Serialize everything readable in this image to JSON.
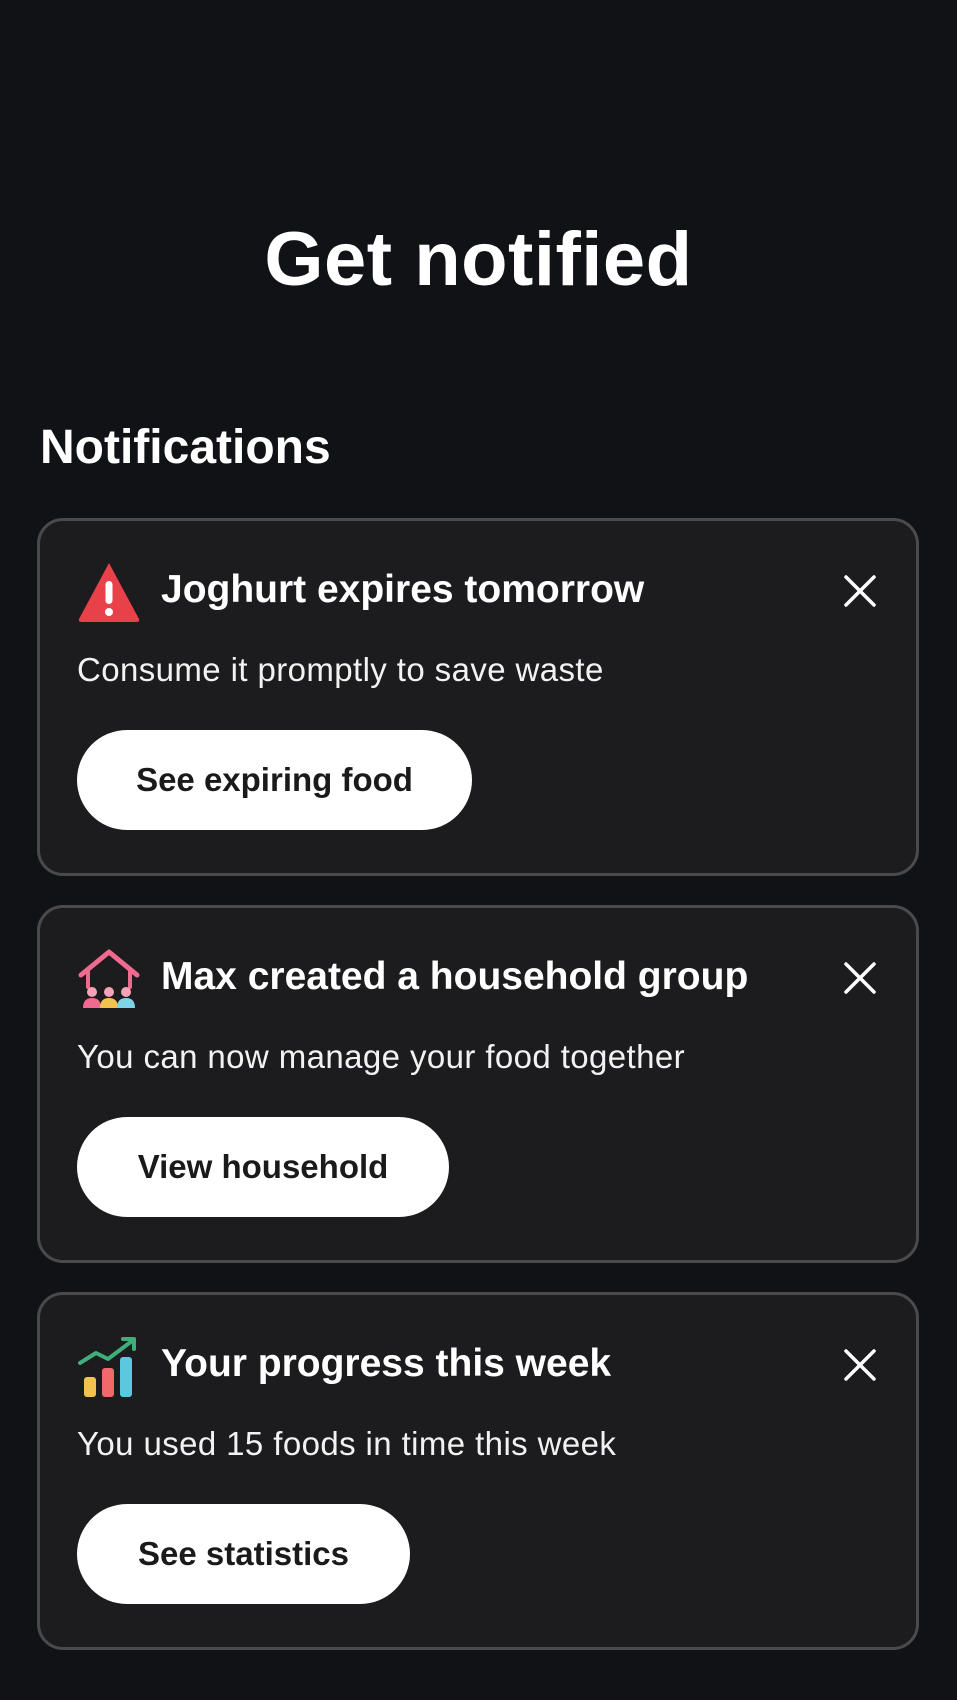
{
  "header": {
    "title": "Get notified"
  },
  "section": {
    "title": "Notifications"
  },
  "notifications": [
    {
      "icon": "warning-triangle-icon",
      "title": "Joghurt expires tomorrow",
      "body": "Consume it promptly to save waste",
      "action_label": "See expiring food"
    },
    {
      "icon": "household-icon",
      "title": "Max created a household group",
      "body": "You can now manage your food together",
      "action_label": "View household"
    },
    {
      "icon": "progress-chart-icon",
      "title": "Your progress this week",
      "body": "You used 15 foods in time this week",
      "action_label": "See statistics"
    }
  ],
  "colors": {
    "background": "#111216",
    "card": "#1c1c1e",
    "card_border": "#4a4a4d",
    "warning": "#e8414a",
    "household": "#f06a8f",
    "button": "#ffffff"
  }
}
